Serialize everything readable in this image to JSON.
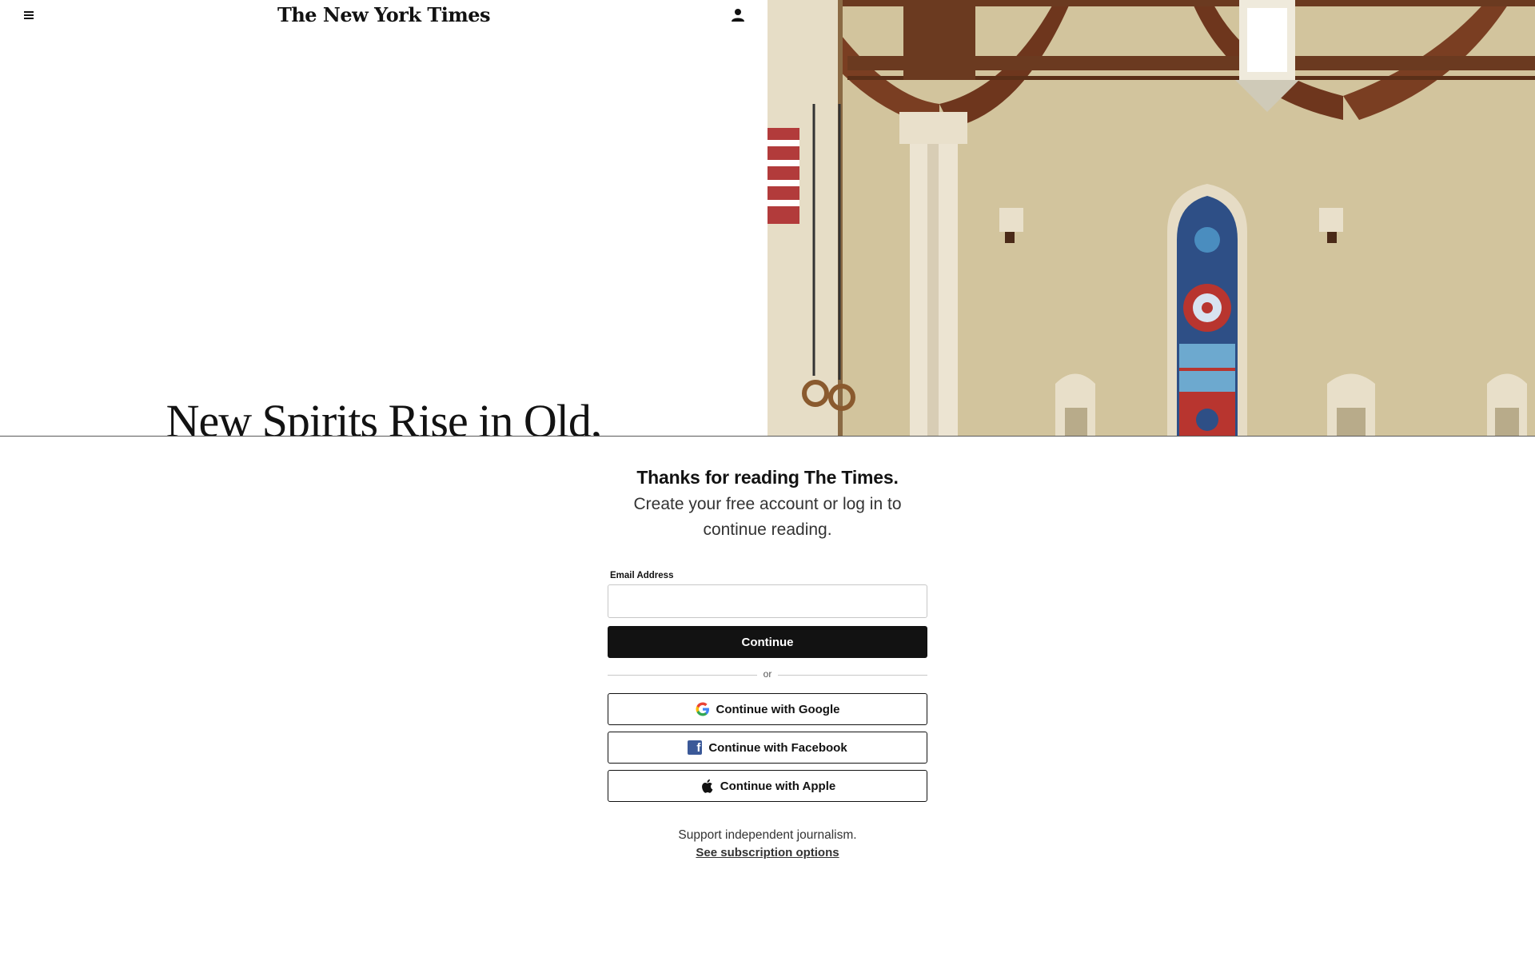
{
  "header": {
    "logo_text": "The New York Times"
  },
  "article": {
    "headline": "New Spirits Rise in Old,"
  },
  "regiwall": {
    "title": "Thanks for reading The Times.",
    "subtitle": "Create your free account or log in to continue reading.",
    "email_label": "Email Address",
    "email_value": "",
    "continue_label": "Continue",
    "or_label": "or",
    "google_label": "Continue with Google",
    "facebook_label": "Continue with Facebook",
    "apple_label": "Continue with Apple",
    "support_text": "Support independent journalism.",
    "subscription_link": "See subscription options"
  },
  "icons": [
    "menu-icon",
    "account-icon",
    "google-icon",
    "facebook-icon",
    "apple-icon"
  ],
  "colors": {
    "button_dark": "#121212",
    "facebook_blue": "#3b5998",
    "wall_tint": "#d1c29a"
  }
}
